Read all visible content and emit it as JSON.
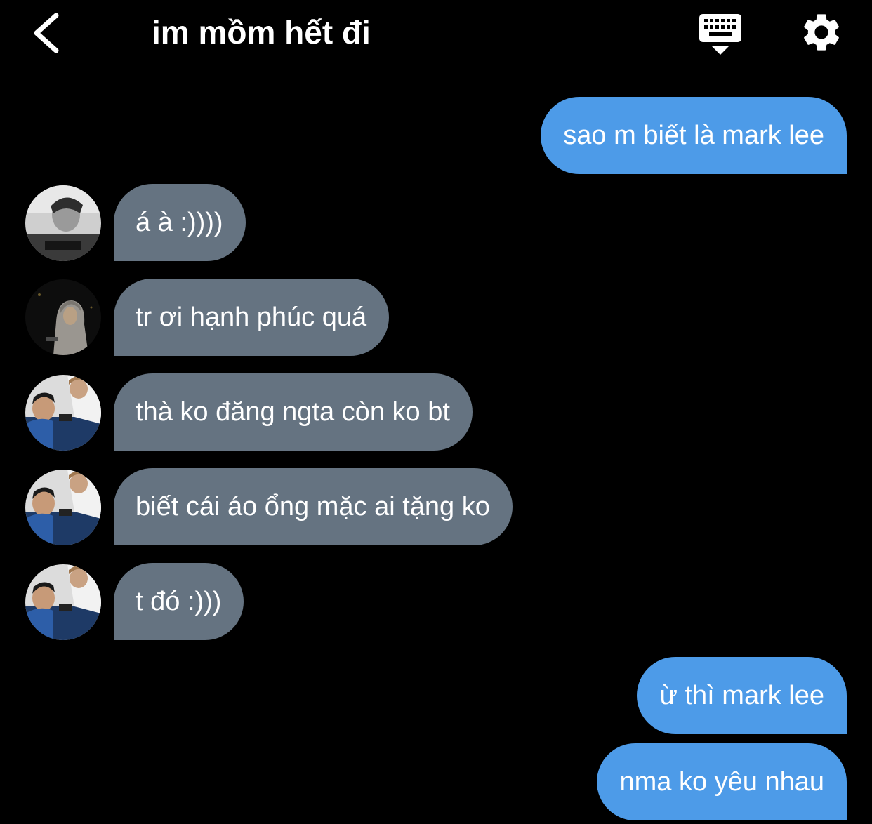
{
  "header": {
    "title": "im mồm hết đi",
    "back_icon": "chevron-left-icon",
    "keyboard_icon": "keyboard-icon",
    "settings_icon": "gear-icon"
  },
  "colors": {
    "background": "#000000",
    "outgoing_bubble": "#4d9be8",
    "incoming_bubble": "#657381",
    "text": "#ffffff"
  },
  "messages": [
    {
      "direction": "outgoing",
      "text": "sao m biết là mark lee"
    },
    {
      "direction": "incoming",
      "avatar": "avatar-grayscale-portrait",
      "text": "á à :))))"
    },
    {
      "direction": "incoming",
      "avatar": "avatar-hoodie-night",
      "text": "tr ơi hạnh phúc quá"
    },
    {
      "direction": "incoming",
      "avatar": "avatar-two-people-phone",
      "text": "thà ko đăng ngta còn ko bt"
    },
    {
      "direction": "incoming",
      "avatar": "avatar-two-people-phone",
      "text": "biết cái áo ổng mặc ai tặng ko"
    },
    {
      "direction": "incoming",
      "avatar": "avatar-two-people-phone",
      "text": "t đó :)))"
    },
    {
      "direction": "outgoing",
      "text": "ừ thì mark lee"
    },
    {
      "direction": "outgoing",
      "text": "nma ko yêu nhau"
    }
  ]
}
